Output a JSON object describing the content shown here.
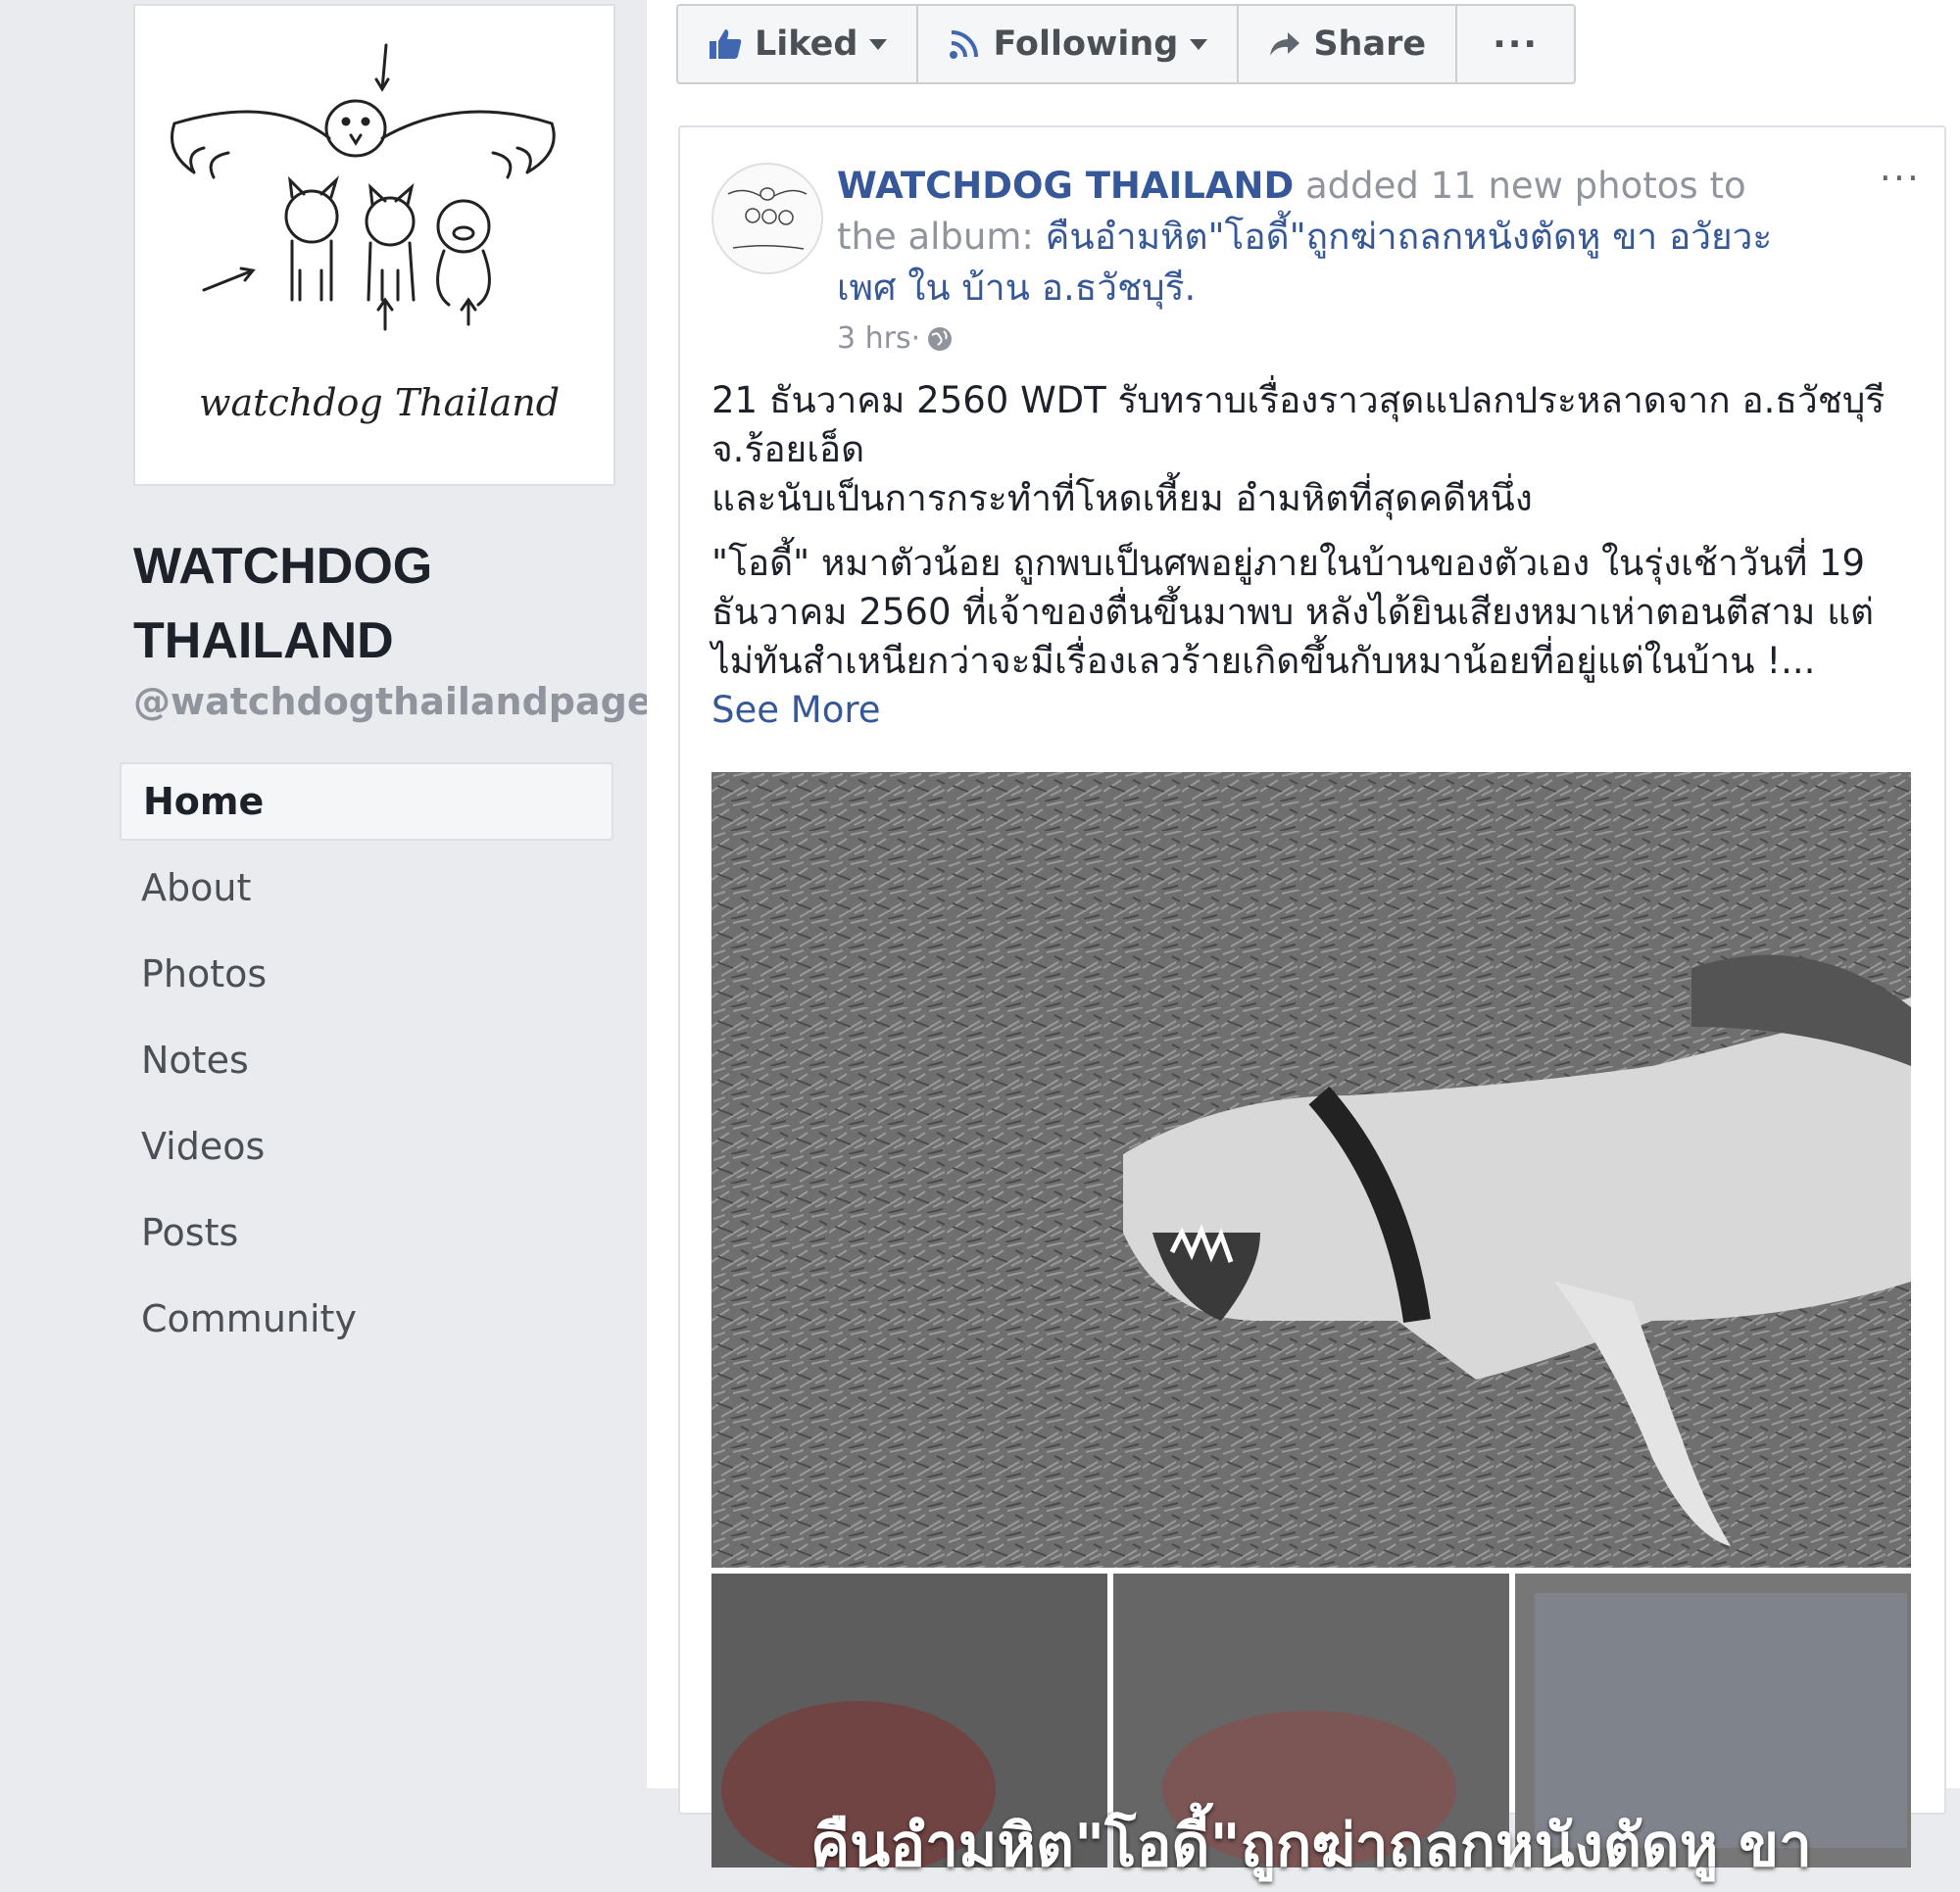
{
  "page": {
    "name": "WATCHDOG THAILAND",
    "handle": "@watchdogthailandpage",
    "logo_text": "watchdog Thailand"
  },
  "nav": {
    "items": [
      {
        "label": "Home",
        "active": true
      },
      {
        "label": "About"
      },
      {
        "label": "Photos"
      },
      {
        "label": "Notes"
      },
      {
        "label": "Videos"
      },
      {
        "label": "Posts"
      },
      {
        "label": "Community"
      }
    ]
  },
  "actions": {
    "liked": "Liked",
    "following": "Following",
    "share": "Share",
    "more": "···"
  },
  "post": {
    "author": "WATCHDOG THAILAND",
    "action_text": " added 11 new photos to the album: ",
    "album_title": "คืนอำมหิต\"โอดี้\"ถูกฆ่าถลกหนังตัดหู ขา อวัยวะเพศ ใน บ้าน อ.ธวัชบุรี.",
    "time": "3 hrs",
    "meta_sep": " · ",
    "more": "···",
    "paragraph1_line1": "21 ธันวาคม 2560 WDT รับทราบเรื่องราวสุดแปลกประหลาดจาก อ.ธวัชบุรี จ.ร้อยเอ็ด",
    "paragraph1_line2": "และนับเป็นการกระทำที่โหดเหี้ยม อำมหิตที่สุดคดีหนึ่ง",
    "paragraph2": "\"โอดี้\" หมาตัวน้อย ถูกพบเป็นศพอยู่ภายในบ้านของตัวเอง ในรุ่งเช้าวันที่ 19 ธันวาคม 2560 ที่เจ้าของตื่นขึ้นมาพบ หลังได้ยินเสียงหมาเห่าตอนตีสาม แต่ไม่ทันสำเหนียกว่าจะมีเรื่องเลวร้ายเกิดขึ้นกับหมาน้อยที่อยู่แต่ในบ้าน !...",
    "see_more": "See More",
    "album_overlay": "คืนอำมหิต\"โอดี้\"ถูกฆ่าถลกหนังตัดหู ขา"
  },
  "colors": {
    "link": "#365899",
    "background": "#e9ebee",
    "muted": "#90949c"
  }
}
